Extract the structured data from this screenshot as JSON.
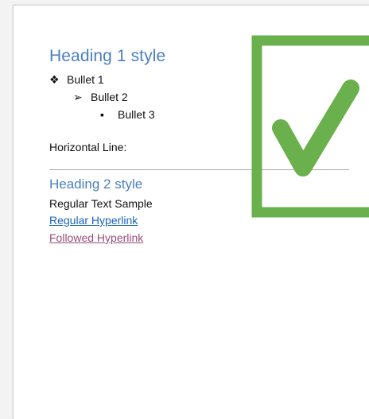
{
  "document": {
    "heading1": "Heading 1 style",
    "bullets": [
      {
        "glyph_icon": "diamond-bullet-icon",
        "text": "Bullet 1"
      },
      {
        "glyph_icon": "arrow-bullet-icon",
        "text": "Bullet 2"
      },
      {
        "glyph_icon": "square-bullet-icon",
        "text": "Bullet 3"
      }
    ],
    "horizontal_line_label": "Horizontal Line:",
    "heading2": "Heading 2 style",
    "regular_text": "Regular Text Sample",
    "hyperlink": "Regular Hyperlink",
    "followed_hyperlink": "Followed Hyperlink"
  },
  "overlay": {
    "icon": "checkmark-icon",
    "color": "#6ab04c"
  },
  "colors": {
    "heading": "#4a7fbf",
    "hyperlink": "#1b64b7",
    "followed_hyperlink": "#9a4d79",
    "rule": "#a8a8a8"
  }
}
